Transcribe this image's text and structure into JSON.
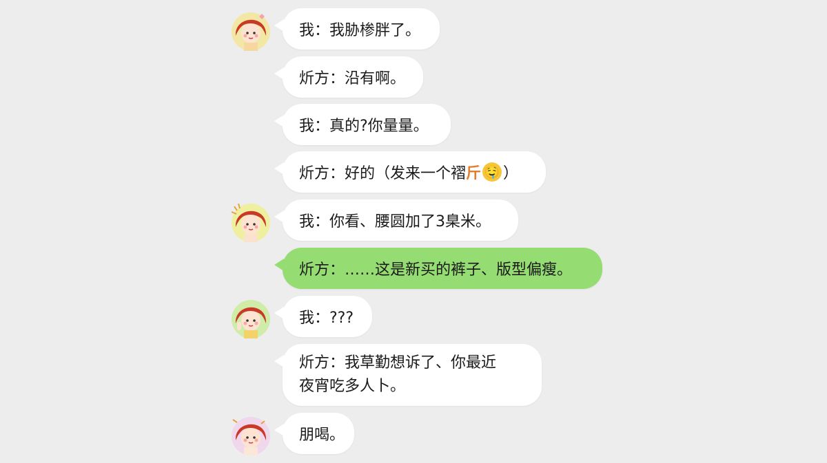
{
  "messages": [
    {
      "text": "我：我胁椮胖了。",
      "avatar": true
    },
    {
      "text": "炘方：沿有啊。",
      "avatar": false
    },
    {
      "text": "我：真的?你量量。",
      "avatar": false
    },
    {
      "text_before": "炘方：好的（发来一个褶",
      "text_orange": "斤",
      "emoji": "🤤",
      "text_after": "）",
      "avatar": false
    },
    {
      "text": "我：你看、腰圆加了3臬米。",
      "avatar": true
    },
    {
      "text": "炘方：……这是新买的裤子、版型偏瘦。",
      "avatar": false,
      "highlight": true
    },
    {
      "text": "我：???",
      "avatar": true
    },
    {
      "text_line1": "炘方：我草勤想诉了、你最近",
      "text_line2": "夜宵吃多人卜。",
      "avatar": false
    },
    {
      "text": "朋喝。",
      "avatar": true
    }
  ],
  "colors": {
    "background": "#ededee",
    "bubble": "#ffffff",
    "highlight_bubble": "#95dc72"
  }
}
